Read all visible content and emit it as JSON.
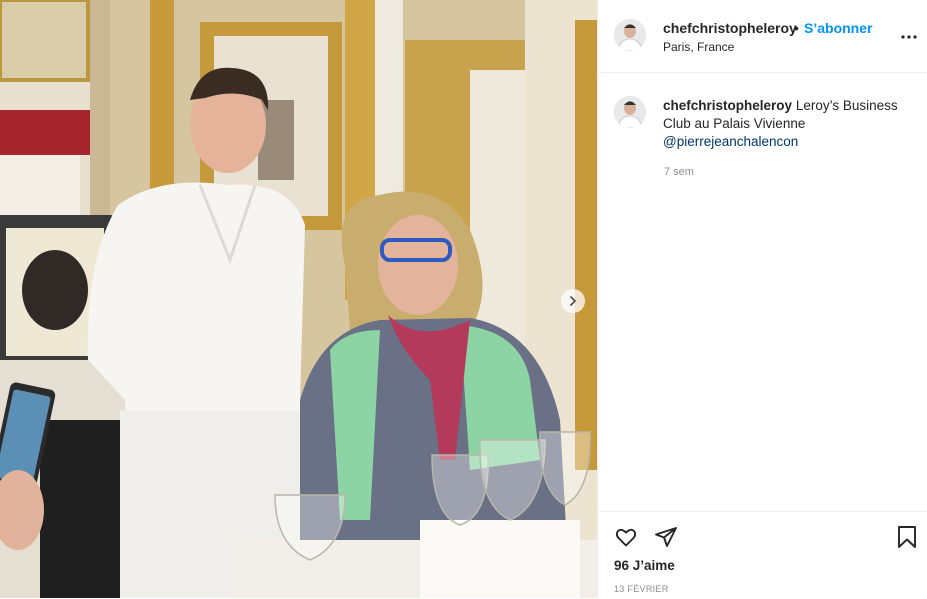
{
  "post": {
    "username": "chefchristopheleroy",
    "dot": "•",
    "follow_label": "S’abonner",
    "location": "Paris, France",
    "more_icon": "more-horizontal-icon"
  },
  "caption": {
    "username": "chefchristopheleroy",
    "text": "Leroy’s Business Club au Palais Vivienne",
    "mention": "@pierrejeanchalencon",
    "time_ago": "7 sem"
  },
  "engagement": {
    "likes": "96 J’aime",
    "date": "13 FÉVRIER",
    "icons": [
      "heart-icon",
      "share-icon",
      "bookmark-icon"
    ]
  },
  "media": {
    "next_icon": "chevron-right-icon"
  }
}
